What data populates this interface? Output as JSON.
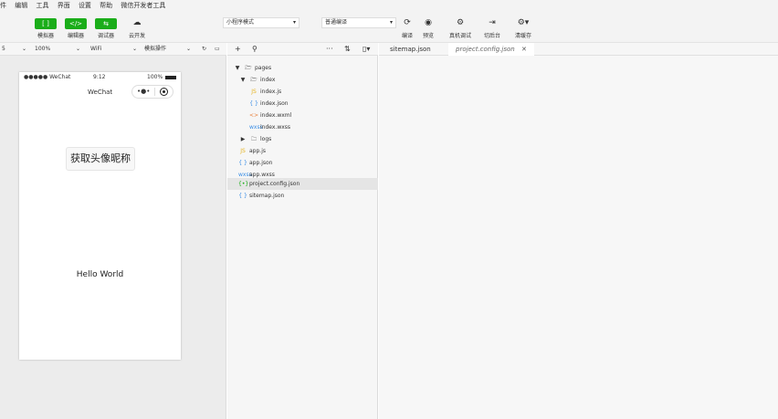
{
  "menu": [
    "件",
    "编辑",
    "工具",
    "界面",
    "设置",
    "帮助",
    "微信开发者工具"
  ],
  "toolbar": {
    "buttons": [
      {
        "icon": "[ ]",
        "label": "模拟器"
      },
      {
        "icon": "</>",
        "label": "编辑器"
      },
      {
        "icon": "⇆",
        "label": "调试器"
      }
    ],
    "cloud_label": "云开发",
    "mode_select": "小程序模式",
    "compile_select": "普通编译",
    "compile_label": "编译",
    "preview_label": "预览",
    "realdebug_label": "真机调试",
    "background_label": "切后台",
    "cache_label": "清缓存"
  },
  "simulator": {
    "device_select": "5",
    "zoom_select": "100%",
    "network_select": "WiFi",
    "action_select": "模拟操作",
    "status_carrier": "●●●●● WeChat",
    "status_time": "9:12",
    "status_battery": "100%",
    "nav_title": "WeChat",
    "avatar_button": "获取头像昵称",
    "hello_text": "Hello World"
  },
  "tree": [
    {
      "name": "pages",
      "icon": "folder-open-icon",
      "type": "folder"
    },
    {
      "name": "index",
      "icon": "folder-open-icon",
      "type": "folder"
    },
    {
      "name": "index.js",
      "icon": "js-file-icon",
      "type": "file"
    },
    {
      "name": "index.json",
      "icon": "json-file-icon",
      "type": "file"
    },
    {
      "name": "index.wxml",
      "icon": "wxml-file-icon",
      "type": "file"
    },
    {
      "name": "index.wxss",
      "icon": "wxss-file-icon",
      "type": "file"
    },
    {
      "name": "logs",
      "icon": "folder-icon",
      "type": "folder"
    },
    {
      "name": "app.js",
      "icon": "js-file-icon",
      "type": "file"
    },
    {
      "name": "app.json",
      "icon": "json-file-icon",
      "type": "file"
    },
    {
      "name": "app.wxss",
      "icon": "wxss-file-icon",
      "type": "file"
    },
    {
      "name": "project.config.json",
      "icon": "config-file-icon",
      "type": "file"
    },
    {
      "name": "sitemap.json",
      "icon": "json-file-icon",
      "type": "file"
    }
  ],
  "tabs": [
    {
      "name": "sitemap.json"
    },
    {
      "name": "project.config.json",
      "close": "✕"
    }
  ],
  "colors": {
    "accent": "#1aad19",
    "js": "#e6b422",
    "json": "#3a8ee6",
    "wxml": "#e8803c",
    "wxss": "#3a8ee6",
    "config": "#1aad19"
  }
}
